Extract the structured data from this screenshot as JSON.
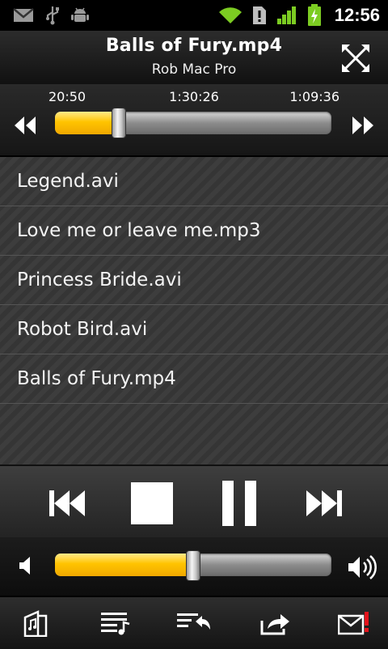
{
  "status_bar": {
    "time": "12:56",
    "icons": [
      "gmail-icon",
      "usb-icon",
      "android-debug-icon",
      "wifi-icon",
      "alert-icon",
      "signal-icon",
      "battery-charging-icon"
    ]
  },
  "header": {
    "title": "Balls of Fury.mp4",
    "source": "Rob Mac Pro",
    "fullscreen_icon": "fullscreen-icon"
  },
  "seek": {
    "elapsed": "20:50",
    "total": "1:30:26",
    "remaining": "1:09:36",
    "progress": 0.23
  },
  "playlist": {
    "items": [
      {
        "label": "Legend.avi"
      },
      {
        "label": "Love me or leave me.mp3"
      },
      {
        "label": "Princess Bride.avi"
      },
      {
        "label": "Robot Bird.avi"
      },
      {
        "label": "Balls of Fury.mp4"
      }
    ]
  },
  "controls": {
    "icons": [
      "previous-icon",
      "stop-icon",
      "pause-icon",
      "next-icon"
    ]
  },
  "volume": {
    "level": 0.5
  },
  "toolbar": {
    "icons": [
      "open-folder-icon",
      "playlist-icon",
      "queue-back-icon",
      "share-icon",
      "mail-alert-icon"
    ]
  },
  "colors": {
    "accent": "#ffc400",
    "background": "#1a1a1a"
  }
}
